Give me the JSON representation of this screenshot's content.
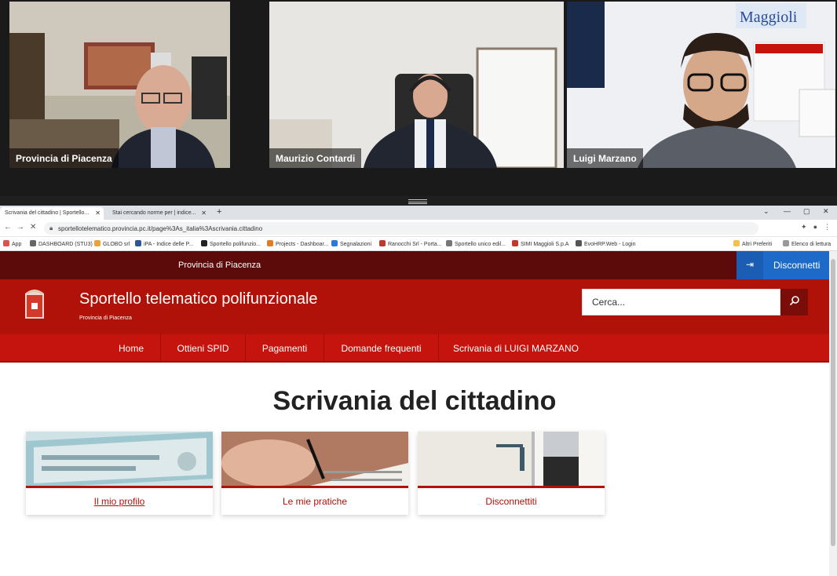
{
  "meeting": {
    "participants": [
      {
        "name": "Provincia di Piacenza"
      },
      {
        "name": "Maurizio Contardi"
      },
      {
        "name": "Luigi Marzano"
      }
    ],
    "accent": "#23c552",
    "poster_text": "Maggioli"
  },
  "browser": {
    "tabs": [
      {
        "label": "Scrivania del cittadino | Sportello...",
        "active": true
      },
      {
        "label": "Stai cercando norme per | indice...",
        "active": false
      }
    ],
    "new_tab": "+",
    "url": "sportellotelematico.provincia.pc.it/page%3As_italia%3Ascrivania.cittadino",
    "bookmarks": [
      "App",
      "DASHBOARD (STU3)",
      "GLOBO srl",
      "iPA - Indice delle P...",
      "Sportello polifunzio...",
      "Projects - Dashboar...",
      "Segnalazioni",
      "Ranocchi Srl - Porta...",
      "Sportello unico edil...",
      "SIMI Maggioli S.p.A",
      "EvoHRP.Web - Login"
    ],
    "bookmarks_right": [
      "Altri Preferiti",
      "Elenco di lettura"
    ]
  },
  "site": {
    "top_label": "Provincia di Piacenza",
    "logout_label": "Disconnetti",
    "title": "Sportello telematico polifunzionale",
    "subtitle": "Provincia di Piacenza",
    "search_placeholder": "Cerca...",
    "nav": [
      "Home",
      "Ottieni SPID",
      "Pagamenti",
      "Domande frequenti",
      "Scrivania di LUIGI MARZANO"
    ],
    "page_title": "Scrivania del cittadino",
    "cards": [
      {
        "label": "Il mio profilo"
      },
      {
        "label": "Le mie pratiche"
      },
      {
        "label": "Disconnettiti"
      }
    ],
    "colors": {
      "brand_red": "#b01109",
      "dark_red": "#5c0a0a",
      "logout_blue": "#1e6ac9"
    }
  }
}
